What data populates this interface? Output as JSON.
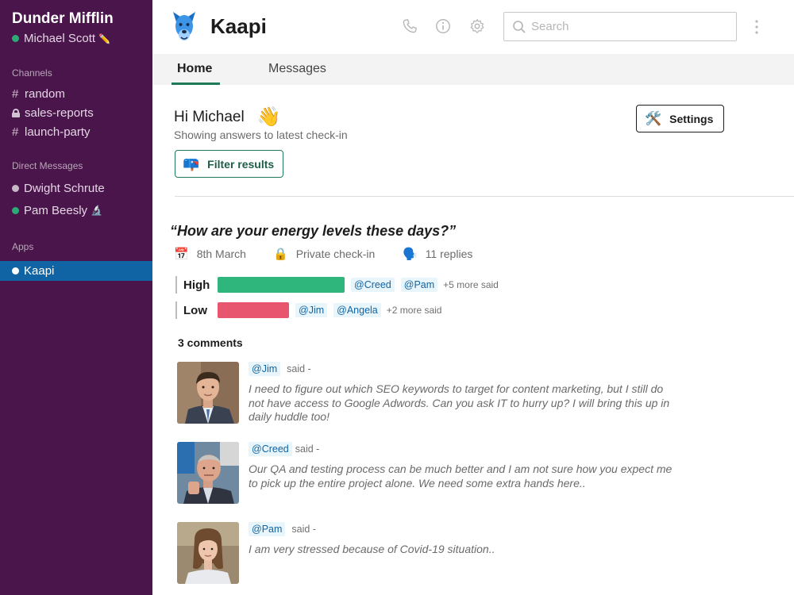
{
  "sidebar": {
    "workspace": "Dunder Mifflin",
    "user": "Michael Scott",
    "user_emoji": "✏️",
    "channels_heading": "Channels",
    "channels": [
      {
        "name": "random",
        "icon": "hash"
      },
      {
        "name": "sales-reports",
        "icon": "lock"
      },
      {
        "name": "launch-party",
        "icon": "hash"
      }
    ],
    "dm_heading": "Direct Messages",
    "dms": [
      {
        "name": "Dwight Schrute",
        "status": "away",
        "emoji": ""
      },
      {
        "name": "Pam Beesly",
        "status": "online",
        "emoji": "🔬"
      }
    ],
    "apps_heading": "Apps",
    "apps": [
      {
        "name": "Kaapi",
        "active": true
      }
    ]
  },
  "header": {
    "app_name": "Kaapi",
    "search_placeholder": "Search",
    "icons": [
      "phone-icon",
      "info-icon",
      "gear-icon",
      "kebab-menu-icon"
    ]
  },
  "tabs": [
    {
      "label": "Home",
      "active": true
    },
    {
      "label": "Messages",
      "active": false
    }
  ],
  "main": {
    "greeting": "Hi Michael",
    "greeting_emoji": "👋",
    "subtitle": "Showing  answers to latest check-in",
    "settings_button": "Settings",
    "settings_emoji": "🛠️",
    "filter_button": "Filter results",
    "filter_emoji": "📪"
  },
  "checkin": {
    "question": "“How are your energy levels these days?”",
    "date": "8th March",
    "privacy": "Private check-in",
    "replies": "11 replies",
    "date_emoji": "📅",
    "privacy_emoji": "🔒",
    "replies_emoji": "🗣️",
    "answers": [
      {
        "label": "High",
        "share": 0.59,
        "color": "#2eb67d",
        "mentions": [
          "@Creed",
          "@Pam"
        ],
        "more": "+5 more said"
      },
      {
        "label": "Low",
        "share": 0.33,
        "color": "#e8556e",
        "mentions": [
          "@Jim",
          "@Angela"
        ],
        "more": "+2 more said"
      }
    ]
  },
  "comments": {
    "title": "3 comments",
    "items": [
      {
        "author": "@Jim",
        "said": "said -",
        "text": "I need to figure out which SEO keywords to target for content marketing, but I still do not have access to Google Adwords. Can you ask IT to hurry up? I will bring this up in daily huddle too!"
      },
      {
        "author": "@Creed",
        "said": "said -",
        "text": "Our QA and testing process can be much better and I am not sure how you expect me to pick up the entire project alone. We need some extra hands here.."
      },
      {
        "author": "@Pam",
        "said": "said -",
        "text": "I am very stressed because of Covid-19 situation.."
      }
    ]
  }
}
